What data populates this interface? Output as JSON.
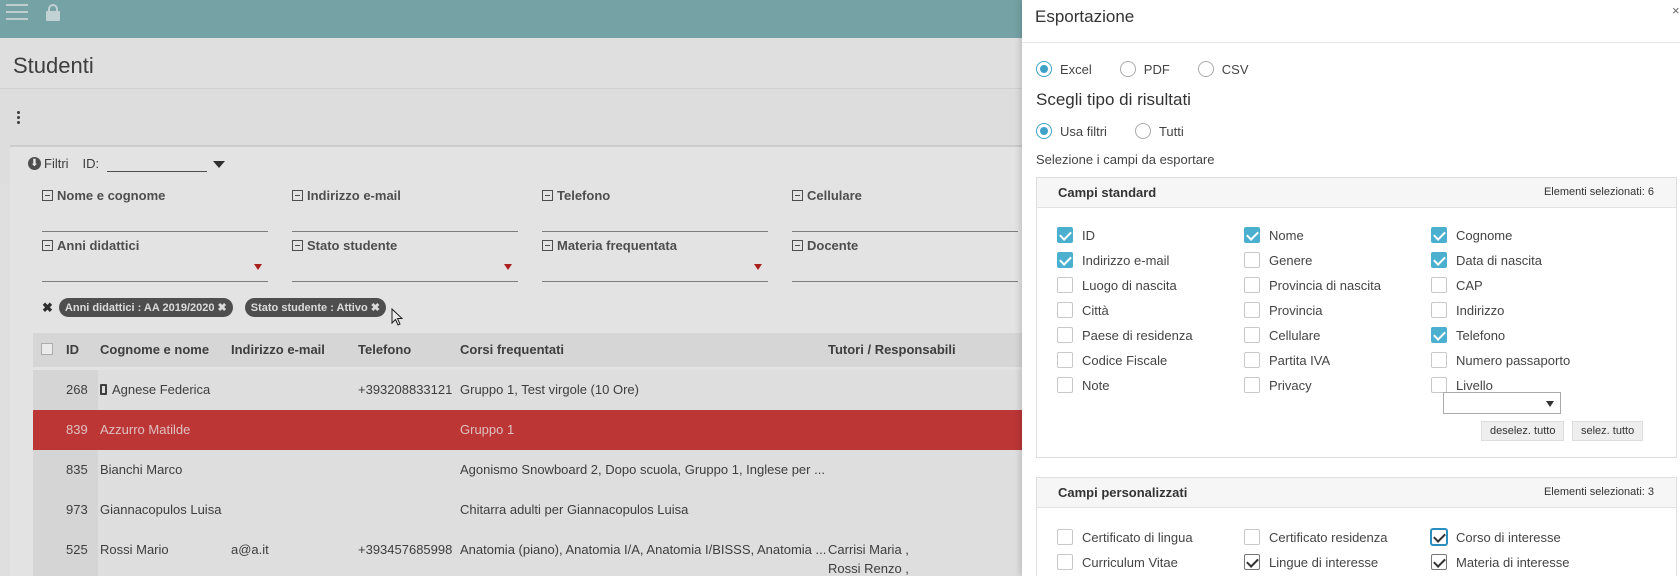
{
  "app": {
    "page_title": "Studenti"
  },
  "filters": {
    "toggle_label": "Filtri",
    "id_label": "ID:",
    "fields": [
      "Nome e cognome",
      "Indirizzo e-mail",
      "Telefono",
      "Cellulare",
      "Anni didattici",
      "Stato studente",
      "Materia frequentata",
      "Docente"
    ],
    "chips": [
      "Anni didattici : AA 2019/2020",
      "Stato studente : Attivo"
    ]
  },
  "table": {
    "headers": [
      "ID",
      "Cognome e nome",
      "Indirizzo e-mail",
      "Telefono",
      "Corsi frequentati",
      "Tutori / Responsabili"
    ],
    "rows": [
      {
        "id": "268",
        "name": "Agnese Federica",
        "email": "",
        "phone": "+393208833121",
        "courses": "Gruppo 1, Test virgole (10 Ore)",
        "tutors": "",
        "mobile": true
      },
      {
        "id": "839",
        "name": "Azzurro Matilde",
        "email": "",
        "phone": "",
        "courses": "Gruppo 1",
        "tutors": "",
        "selected": true
      },
      {
        "id": "835",
        "name": "Bianchi Marco",
        "email": "",
        "phone": "",
        "courses": "Agonismo Snowboard 2, Dopo scuola, Gruppo 1, Inglese per ...",
        "tutors": ""
      },
      {
        "id": "973",
        "name": "Giannacopulos Luisa",
        "email": "",
        "phone": "",
        "courses": "Chitarra adulti per Giannacopulos Luisa",
        "tutors": ""
      },
      {
        "id": "525",
        "name": "Rossi Mario",
        "email": "a@a.it",
        "phone": "+393457685998",
        "courses": "Anatomia (piano), Anatomia I/A, Anatomia I/BISSS, Anatomia ...",
        "tutors": "Carrisi Maria ,",
        "tutors2": "Rossi Renzo ,"
      }
    ]
  },
  "export": {
    "title": "Esportazione",
    "close": "×",
    "formats": [
      {
        "label": "Excel",
        "checked": true
      },
      {
        "label": "PDF",
        "checked": false
      },
      {
        "label": "CSV",
        "checked": false
      }
    ],
    "result_type_title": "Scegli tipo di risultati",
    "result_types": [
      {
        "label": "Usa filtri",
        "checked": true
      },
      {
        "label": "Tutti",
        "checked": false
      }
    ],
    "select_fields_text": "Selezione i campi da esportare",
    "standard": {
      "title": "Campi standard",
      "count": "Elementi selezionati: 6",
      "fields": [
        {
          "label": "ID",
          "checked": true
        },
        {
          "label": "Nome",
          "checked": true
        },
        {
          "label": "Cognome",
          "checked": true
        },
        {
          "label": "Indirizzo e-mail",
          "checked": true
        },
        {
          "label": "Genere",
          "checked": false
        },
        {
          "label": "Data di nascita",
          "checked": true
        },
        {
          "label": "Luogo di nascita",
          "checked": false
        },
        {
          "label": "Provincia di nascita",
          "checked": false
        },
        {
          "label": "CAP",
          "checked": false
        },
        {
          "label": "Città",
          "checked": false
        },
        {
          "label": "Provincia",
          "checked": false
        },
        {
          "label": "Indirizzo",
          "checked": false
        },
        {
          "label": "Paese di residenza",
          "checked": false
        },
        {
          "label": "Cellulare",
          "checked": false
        },
        {
          "label": "Telefono",
          "checked": true
        },
        {
          "label": "Codice Fiscale",
          "checked": false
        },
        {
          "label": "Partita IVA",
          "checked": false
        },
        {
          "label": "Numero passaporto",
          "checked": false
        },
        {
          "label": "Note",
          "checked": false
        },
        {
          "label": "Privacy",
          "checked": false
        },
        {
          "label": "Livello",
          "checked": false
        }
      ],
      "deselect_label": "deselez. tutto",
      "select_label": "selez. tutto"
    },
    "custom": {
      "title": "Campi personalizzati",
      "count": "Elementi selezionati: 3",
      "fields": [
        {
          "label": "Certificato di lingua",
          "checked": false
        },
        {
          "label": "Certificato residenza",
          "checked": false
        },
        {
          "label": "Corso di interesse",
          "checked": true
        },
        {
          "label": "Curriculum Vitae",
          "checked": false
        },
        {
          "label": "Lingue di interesse",
          "checked": true
        },
        {
          "label": "Materia di interesse",
          "checked": true
        }
      ]
    },
    "colors": {
      "accent": "#4bb0d0",
      "selected_row": "#cc3b3b",
      "topbar": "#7fb0b4"
    }
  }
}
